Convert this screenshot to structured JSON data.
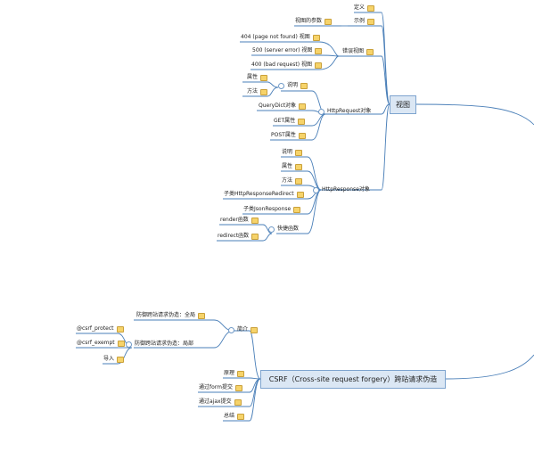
{
  "views_branch": {
    "root": "视图",
    "items": [
      {
        "label": "定义"
      },
      {
        "label": "示例"
      },
      {
        "label": "视图的参数"
      },
      {
        "label": "404 (page not found) 视图"
      },
      {
        "label": "500 (server error) 视图"
      },
      {
        "label": "400 (bad request) 视图"
      },
      {
        "label": "错误视图"
      },
      {
        "label": "属性"
      },
      {
        "label": "方法"
      },
      {
        "label": "说明"
      },
      {
        "label": "QueryDict对象"
      },
      {
        "label": "GET属性"
      },
      {
        "label": "POST属性"
      },
      {
        "label": "HttpRequest对象"
      },
      {
        "label": "说明"
      },
      {
        "label": "属性"
      },
      {
        "label": "方法"
      },
      {
        "label": "子类HttpResponseRedirect"
      },
      {
        "label": "子类JsonResponse"
      },
      {
        "label": "render函数"
      },
      {
        "label": "redirect函数"
      },
      {
        "label": "快捷函数"
      },
      {
        "label": "HttpResponse对象"
      }
    ]
  },
  "csrf_branch": {
    "root": "CSRF（Cross-site request forgery）跨站请求伪造",
    "items": [
      {
        "label": "防御跨站请求伪造：全局"
      },
      {
        "label": "@csrf_protect"
      },
      {
        "label": "@csrf_exempt"
      },
      {
        "label": "导入"
      },
      {
        "label": "防御跨站请求伪造：局部"
      },
      {
        "label": "简介"
      },
      {
        "label": "原理"
      },
      {
        "label": "通过form提交"
      },
      {
        "label": "通过ajax提交"
      },
      {
        "label": "总结"
      }
    ]
  },
  "colors": {
    "line": "#4a7fb8",
    "box_fill": "#dbe7f4",
    "box_border": "#7ea4cf",
    "note": "#f6d36a"
  },
  "icons": {
    "note": "note-icon",
    "collapse": "collapse-bubble-icon"
  }
}
